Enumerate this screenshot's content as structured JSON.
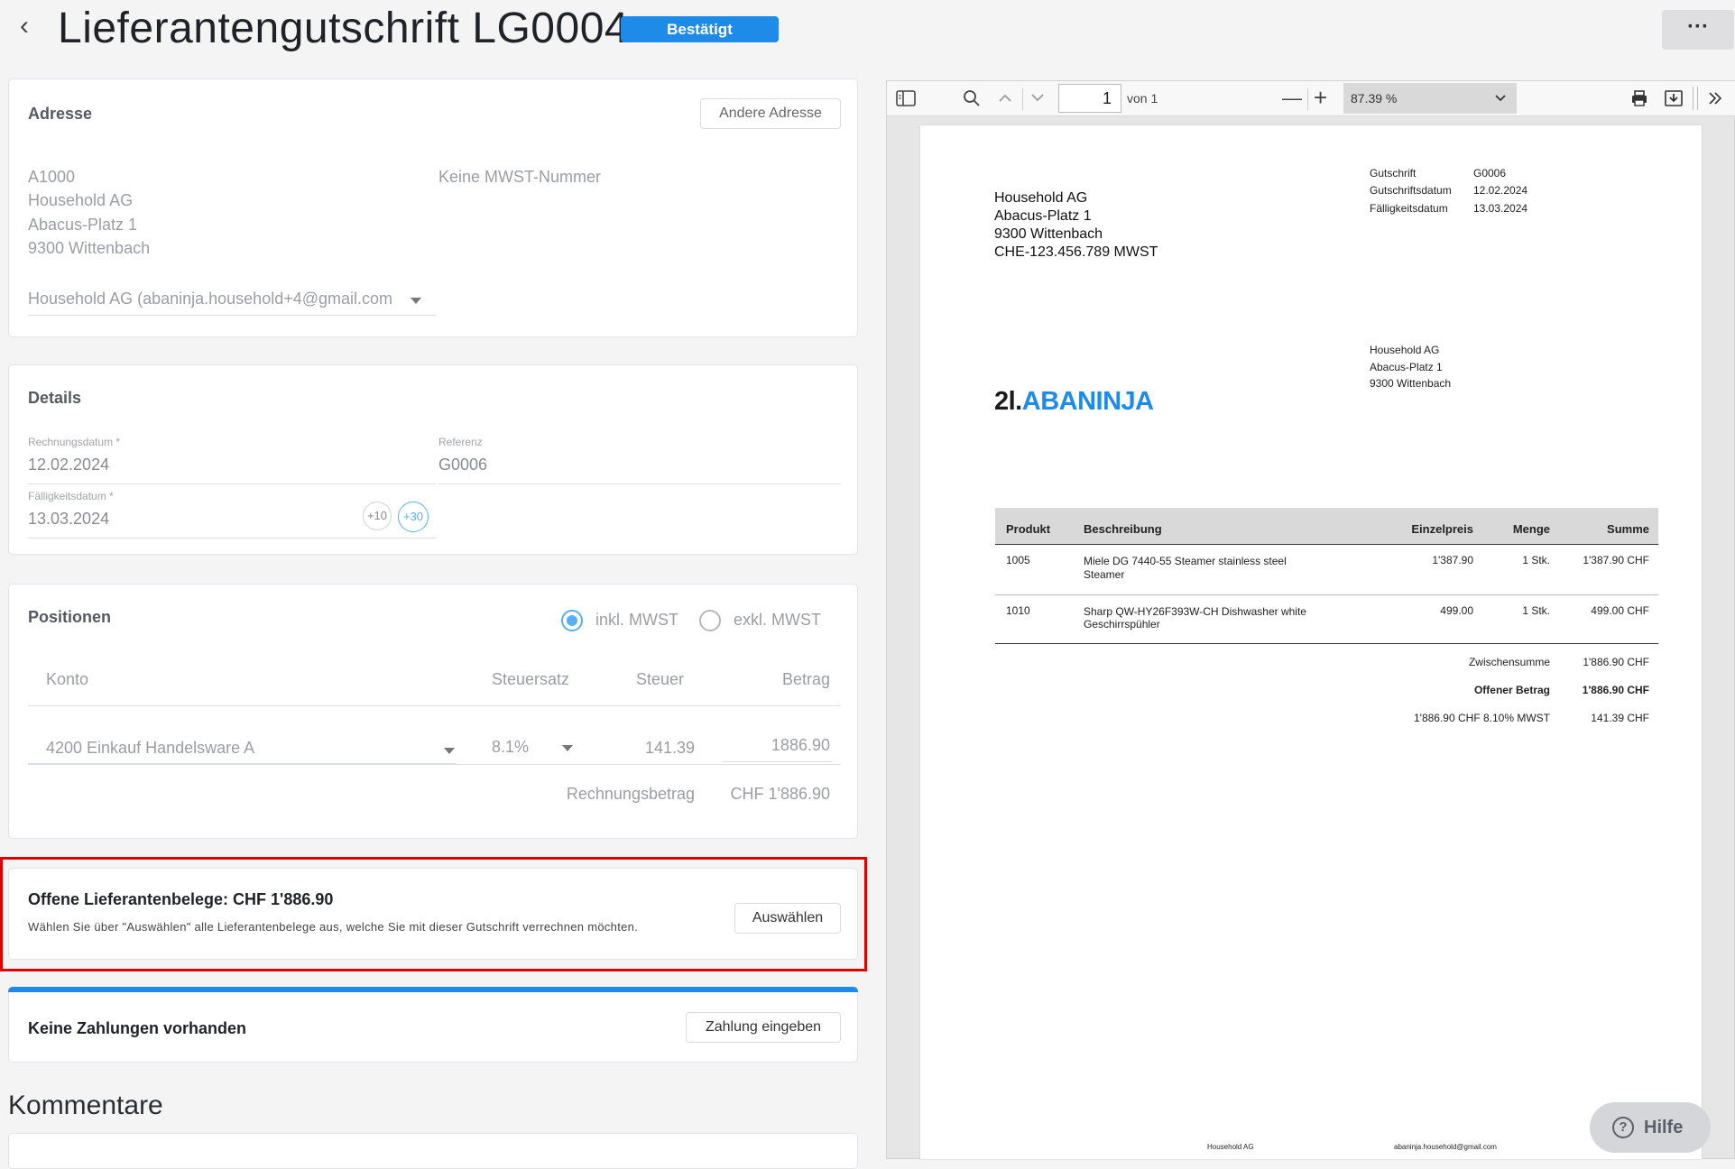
{
  "header": {
    "title": "Lieferantengutschrift LG0004",
    "status": "Bestätigt",
    "more_label": "···"
  },
  "address": {
    "title": "Adresse",
    "other_address_button": "Andere Adresse",
    "lines": [
      "A1000",
      "Household AG",
      "Abacus-Platz 1",
      "9300 Wittenbach"
    ],
    "vat": "Keine MWST-Nummer",
    "contact": "Household AG (abaninja.household+4@gmail.com"
  },
  "details": {
    "title": "Details",
    "invoice_date_label": "Rechnungsdatum *",
    "invoice_date": "12.02.2024",
    "reference_label": "Referenz",
    "reference": "G0006",
    "due_date_label": "Fälligkeitsdatum *",
    "due_date": "13.03.2024",
    "plus10": "+10",
    "plus30": "+30"
  },
  "positions": {
    "title": "Positionen",
    "incl_vat": "inkl. MWST",
    "excl_vat": "exkl. MWST",
    "col_account": "Konto",
    "col_taxrate": "Steuersatz",
    "col_tax": "Steuer",
    "col_amount": "Betrag",
    "account": "4200 Einkauf Handelsware A",
    "taxrate": "8.1%",
    "tax": "141.39",
    "amount": "1886.90",
    "total_label": "Rechnungsbetrag",
    "total": "CHF 1'886.90"
  },
  "open_docs": {
    "title": "Offene Lieferantenbelege: CHF 1'886.90",
    "description": "Wählen Sie über \"Auswählen\" alle Lieferantenbelege aus, welche Sie mit dieser Gutschrift verrechnen möchten.",
    "select_button": "Auswählen",
    "highlight_color": "#e00000"
  },
  "payments": {
    "title": "Keine Zahlungen vorhanden",
    "enter_payment_button": "Zahlung eingeben",
    "accent_color": "#1e8be8"
  },
  "comments": {
    "title": "Kommentare"
  },
  "pdf_toolbar": {
    "page": "1",
    "of_pages": "von 1",
    "zoom": "87.39 %"
  },
  "pdf": {
    "sender": [
      "Household AG",
      "Abacus-Platz 1",
      "9300 Wittenbach",
      "CHE-123.456.789 MWST"
    ],
    "meta_labels": [
      "Gutschrift",
      "Gutschriftsdatum",
      "Fälligkeitsdatum"
    ],
    "meta_values": [
      "G0006",
      "12.02.2024",
      "13.03.2024"
    ],
    "recipient": [
      "Household AG",
      "Abacus-Platz 1",
      "9300 Wittenbach"
    ],
    "logo_prefix": "2l.",
    "logo_text": "ABANINJA",
    "table_headers": [
      "Produkt",
      "Beschreibung",
      "Einzelpreis",
      "Menge",
      "Summe"
    ],
    "rows": [
      {
        "product": "1005",
        "desc1": "Miele DG 7440-55 Steamer stainless steel",
        "desc2": "Steamer",
        "price": "1'387.90",
        "qty": "1 Stk.",
        "sum": "1'387.90 CHF"
      },
      {
        "product": "1010",
        "desc1": "Sharp QW-HY26F393W-CH Dishwasher white",
        "desc2": "Geschirrspühler",
        "price": "499.00",
        "qty": "1 Stk.",
        "sum": "499.00 CHF"
      }
    ],
    "subtotal_label": "Zwischensumme",
    "subtotal": "1'886.90 CHF",
    "open_label": "Offener Betrag",
    "open": "1'886.90 CHF",
    "vat_label": "1'886.90 CHF 8.10% MWST",
    "vat": "141.39 CHF",
    "footer_left": "Household AG",
    "footer_right": "abaninja.household@gmail.com"
  },
  "help": {
    "label": "Hilfe"
  }
}
